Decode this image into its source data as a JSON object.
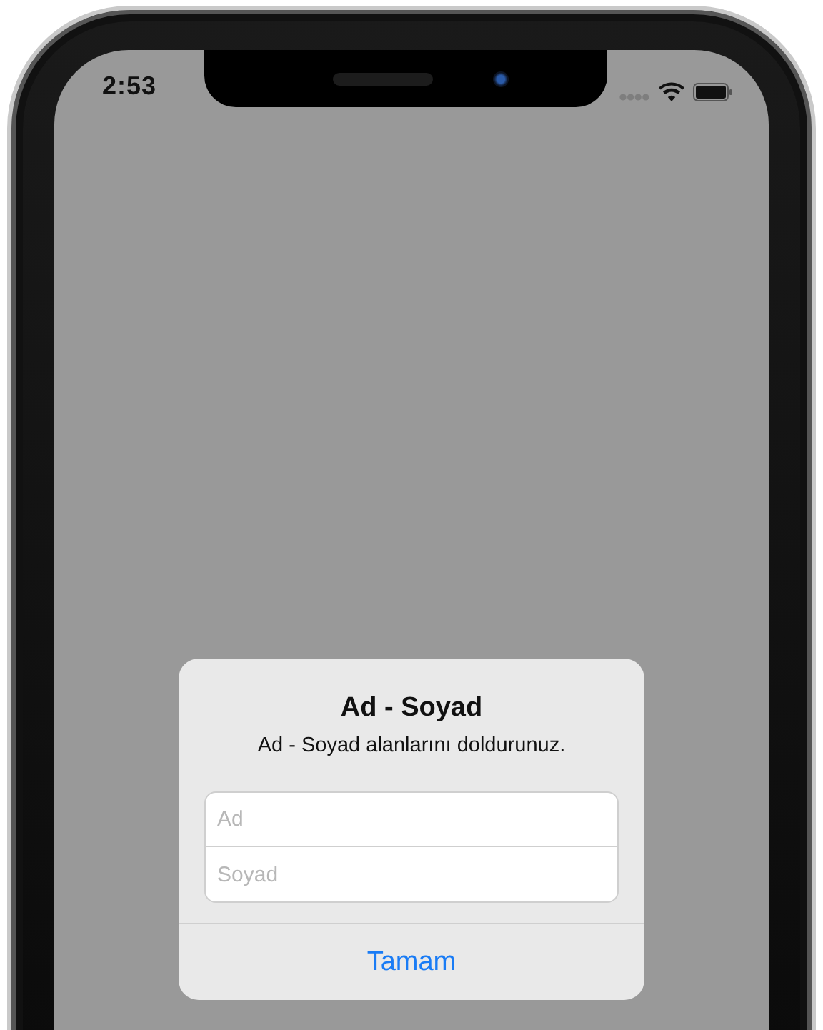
{
  "status_bar": {
    "time": "2:53"
  },
  "alert": {
    "title": "Ad - Soyad",
    "message": "Ad - Soyad alanlarını doldurunuz.",
    "fields": [
      {
        "placeholder": "Ad"
      },
      {
        "placeholder": "Soyad"
      }
    ],
    "buttons": [
      "Tamam"
    ]
  }
}
